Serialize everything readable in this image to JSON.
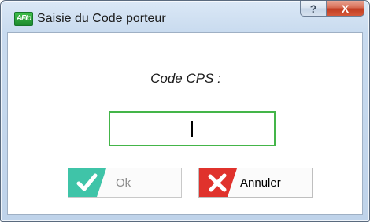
{
  "window": {
    "title": "Saisie du Code porteur",
    "app_icon_text": "AFto",
    "help_glyph": "?",
    "close_glyph": "X"
  },
  "dialog": {
    "prompt": "Code CPS :",
    "input_value": ""
  },
  "buttons": {
    "ok_label": "Ok",
    "ok_enabled": false,
    "cancel_label": "Annuler"
  },
  "colors": {
    "ok_accent": "#3fc4a8",
    "cancel_accent": "#e0322c",
    "input_border": "#44b549"
  },
  "icons": {
    "ok": "check-icon",
    "cancel": "cross-icon"
  }
}
